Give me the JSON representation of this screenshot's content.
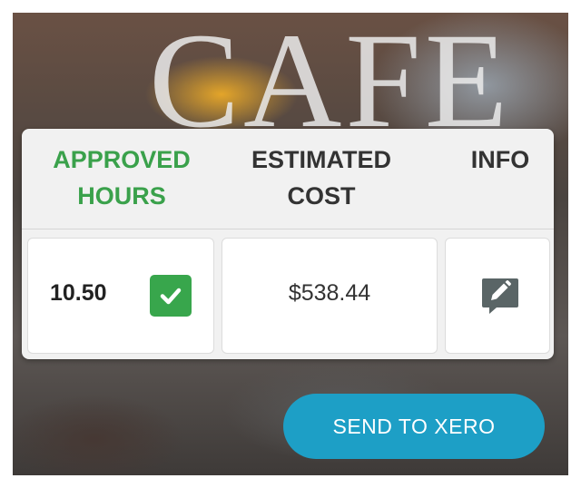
{
  "background": {
    "signage_text": "CAFE"
  },
  "table": {
    "headers": {
      "approved_hours": "APPROVED HOURS",
      "estimated_cost": "ESTIMATED COST",
      "info": "INFO"
    },
    "row": {
      "hours": "10.50",
      "approved": true,
      "cost": "$538.44",
      "info_icon": "edit-comment-icon"
    }
  },
  "actions": {
    "send_label": "SEND TO XERO"
  },
  "colors": {
    "accent_green": "#3aa14b",
    "button_blue": "#1d9fc6",
    "icon_gray": "#5a6566"
  }
}
